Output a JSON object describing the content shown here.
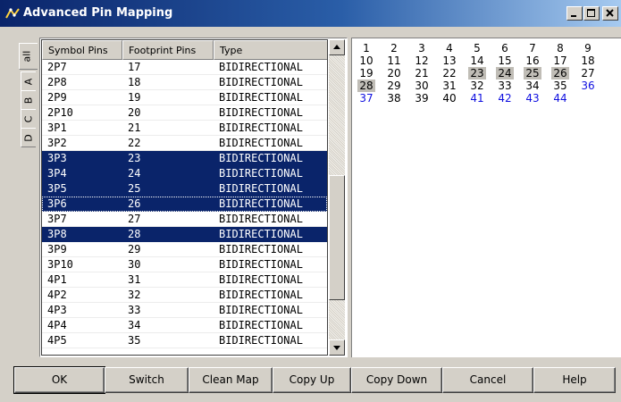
{
  "window": {
    "title": "Advanced Pin Mapping"
  },
  "side_tabs": [
    "all",
    "A",
    "B",
    "C",
    "D"
  ],
  "table": {
    "headers": [
      "Symbol Pins",
      "Footprint Pins",
      "Type"
    ],
    "rows": [
      {
        "symbol": "2P7",
        "footprint": "17",
        "type": "BIDIRECTIONAL",
        "selected": false
      },
      {
        "symbol": "2P8",
        "footprint": "18",
        "type": "BIDIRECTIONAL",
        "selected": false
      },
      {
        "symbol": "2P9",
        "footprint": "19",
        "type": "BIDIRECTIONAL",
        "selected": false
      },
      {
        "symbol": "2P10",
        "footprint": "20",
        "type": "BIDIRECTIONAL",
        "selected": false
      },
      {
        "symbol": "3P1",
        "footprint": "21",
        "type": "BIDIRECTIONAL",
        "selected": false
      },
      {
        "symbol": "3P2",
        "footprint": "22",
        "type": "BIDIRECTIONAL",
        "selected": false
      },
      {
        "symbol": "3P3",
        "footprint": "23",
        "type": "BIDIRECTIONAL",
        "selected": true
      },
      {
        "symbol": "3P4",
        "footprint": "24",
        "type": "BIDIRECTIONAL",
        "selected": true
      },
      {
        "symbol": "3P5",
        "footprint": "25",
        "type": "BIDIRECTIONAL",
        "selected": true
      },
      {
        "symbol": "3P6",
        "footprint": "26",
        "type": "BIDIRECTIONAL",
        "selected": true,
        "focused": true
      },
      {
        "symbol": "3P7",
        "footprint": "27",
        "type": "BIDIRECTIONAL",
        "selected": false
      },
      {
        "symbol": "3P8",
        "footprint": "28",
        "type": "BIDIRECTIONAL",
        "selected": true
      },
      {
        "symbol": "3P9",
        "footprint": "29",
        "type": "BIDIRECTIONAL",
        "selected": false
      },
      {
        "symbol": "3P10",
        "footprint": "30",
        "type": "BIDIRECTIONAL",
        "selected": false
      },
      {
        "symbol": "4P1",
        "footprint": "31",
        "type": "BIDIRECTIONAL",
        "selected": false
      },
      {
        "symbol": "4P2",
        "footprint": "32",
        "type": "BIDIRECTIONAL",
        "selected": false
      },
      {
        "symbol": "4P3",
        "footprint": "33",
        "type": "BIDIRECTIONAL",
        "selected": false
      },
      {
        "symbol": "4P4",
        "footprint": "34",
        "type": "BIDIRECTIONAL",
        "selected": false
      },
      {
        "symbol": "4P5",
        "footprint": "35",
        "type": "BIDIRECTIONAL",
        "selected": false
      }
    ]
  },
  "pin_grid": {
    "columns": 9,
    "pins": [
      {
        "n": "1"
      },
      {
        "n": "2"
      },
      {
        "n": "3"
      },
      {
        "n": "4"
      },
      {
        "n": "5"
      },
      {
        "n": "6"
      },
      {
        "n": "7"
      },
      {
        "n": "8"
      },
      {
        "n": "9"
      },
      {
        "n": "10"
      },
      {
        "n": "11"
      },
      {
        "n": "12"
      },
      {
        "n": "13"
      },
      {
        "n": "14"
      },
      {
        "n": "15"
      },
      {
        "n": "16"
      },
      {
        "n": "17"
      },
      {
        "n": "18"
      },
      {
        "n": "19"
      },
      {
        "n": "20"
      },
      {
        "n": "21"
      },
      {
        "n": "22"
      },
      {
        "n": "23",
        "state": "selected"
      },
      {
        "n": "24",
        "state": "selected"
      },
      {
        "n": "25",
        "state": "selected"
      },
      {
        "n": "26",
        "state": "selected"
      },
      {
        "n": "27"
      },
      {
        "n": "28",
        "state": "selected"
      },
      {
        "n": "29"
      },
      {
        "n": "30"
      },
      {
        "n": "31"
      },
      {
        "n": "32"
      },
      {
        "n": "33"
      },
      {
        "n": "34"
      },
      {
        "n": "35"
      },
      {
        "n": "36",
        "state": "unmapped"
      },
      {
        "n": "37",
        "state": "unmapped"
      },
      {
        "n": "38"
      },
      {
        "n": "39"
      },
      {
        "n": "40"
      },
      {
        "n": "41",
        "state": "unmapped"
      },
      {
        "n": "42",
        "state": "unmapped"
      },
      {
        "n": "43",
        "state": "unmapped"
      },
      {
        "n": "44",
        "state": "unmapped"
      }
    ]
  },
  "buttons": {
    "ok": "OK",
    "switch": "Switch",
    "clean_map": "Clean Map",
    "copy_up": "Copy Up",
    "copy_down": "Copy Down",
    "cancel": "Cancel",
    "help": "Help"
  },
  "colors": {
    "selection": "#0a246a",
    "pin_highlight": "#c0bdb6",
    "pin_unmapped": "#1010e0",
    "face": "#d4d0c8"
  }
}
